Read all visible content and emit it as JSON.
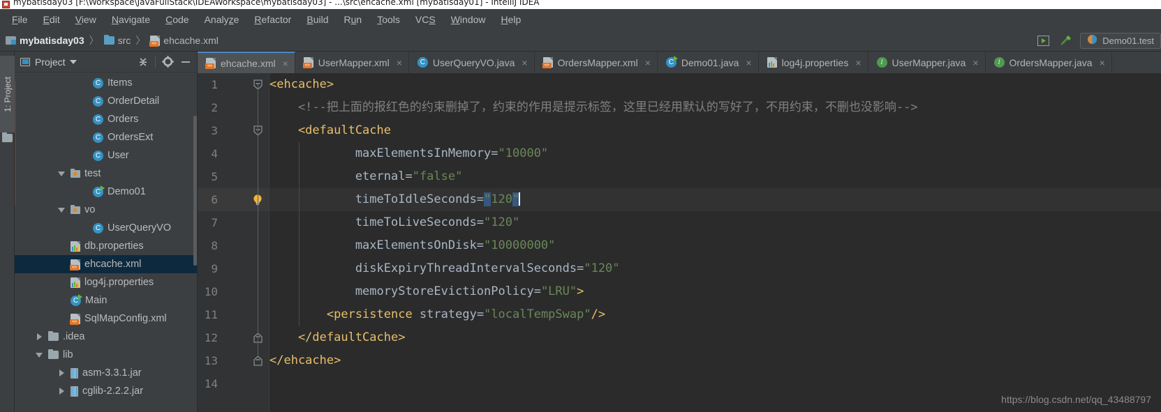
{
  "window": {
    "title": "mybatisday03 [F:\\Workspace\\JavaFullStack\\IDEAWorkspace\\mybatisday03] - ...\\src\\ehcache.xml [mybatisday01] - IntelliJ IDEA",
    "app_icon": "intellij-idea-icon"
  },
  "menubar": {
    "items": [
      {
        "label": "File",
        "mnemonic": "F"
      },
      {
        "label": "Edit",
        "mnemonic": "E"
      },
      {
        "label": "View",
        "mnemonic": "V"
      },
      {
        "label": "Navigate",
        "mnemonic": "N"
      },
      {
        "label": "Code",
        "mnemonic": "C"
      },
      {
        "label": "Analyze",
        "mnemonic": "z"
      },
      {
        "label": "Refactor",
        "mnemonic": "R"
      },
      {
        "label": "Build",
        "mnemonic": "B"
      },
      {
        "label": "Run",
        "mnemonic": "u"
      },
      {
        "label": "Tools",
        "mnemonic": "T"
      },
      {
        "label": "VCS",
        "mnemonic": "S"
      },
      {
        "label": "Window",
        "mnemonic": "W"
      },
      {
        "label": "Help",
        "mnemonic": "H"
      }
    ]
  },
  "navbar": {
    "breadcrumbs": [
      {
        "label": "mybatisday03",
        "icon": "module-icon",
        "bold": true
      },
      {
        "label": "src",
        "icon": "folder-icon",
        "bold": false
      },
      {
        "label": "ehcache.xml",
        "icon": "xml-file-icon",
        "bold": false
      }
    ],
    "separator": "〉",
    "run_button": "run-icon",
    "build_button": "build-hammer-icon",
    "run_config": {
      "label": "Demo01.test",
      "icon": "junit-run-config-icon"
    }
  },
  "toolstrip": {
    "project_tab": "1: Project",
    "folder_icon": "folder-icon"
  },
  "project_panel": {
    "title": "Project",
    "view_icon": "project-view-icon",
    "caret": "chevron-down-icon",
    "actions": [
      {
        "name": "collapse-all-icon"
      },
      {
        "name": "gear-icon"
      },
      {
        "name": "hide-icon"
      }
    ],
    "tree": [
      {
        "label": "Items",
        "icon": "class-icon",
        "indent": 6,
        "toggle": "none",
        "selected": false
      },
      {
        "label": "OrderDetail",
        "icon": "class-icon",
        "indent": 6,
        "toggle": "none",
        "selected": false
      },
      {
        "label": "Orders",
        "icon": "class-icon",
        "indent": 6,
        "toggle": "none",
        "selected": false
      },
      {
        "label": "OrdersExt",
        "icon": "class-icon",
        "indent": 6,
        "toggle": "none",
        "selected": false
      },
      {
        "label": "User",
        "icon": "class-icon",
        "indent": 6,
        "toggle": "none",
        "selected": false
      },
      {
        "label": "test",
        "icon": "source-folder-icon",
        "indent": 4,
        "toggle": "down",
        "selected": false
      },
      {
        "label": "Demo01",
        "icon": "runnable-class-icon",
        "indent": 6,
        "toggle": "none",
        "selected": false
      },
      {
        "label": "vo",
        "icon": "source-folder-icon",
        "indent": 4,
        "toggle": "down",
        "selected": false
      },
      {
        "label": "UserQueryVO",
        "icon": "class-icon",
        "indent": 6,
        "toggle": "none",
        "selected": false
      },
      {
        "label": "db.properties",
        "icon": "properties-icon",
        "indent": 4,
        "toggle": "none",
        "selected": false
      },
      {
        "label": "ehcache.xml",
        "icon": "xml-file-icon",
        "indent": 4,
        "toggle": "none",
        "selected": true
      },
      {
        "label": "log4j.properties",
        "icon": "properties-icon",
        "indent": 4,
        "toggle": "none",
        "selected": false
      },
      {
        "label": "Main",
        "icon": "runnable-class-icon",
        "indent": 4,
        "toggle": "none",
        "selected": false
      },
      {
        "label": "SqlMapConfig.xml",
        "icon": "xml-file-icon",
        "indent": 4,
        "toggle": "none",
        "selected": false
      },
      {
        "label": ".idea",
        "icon": "plain-folder-icon",
        "indent": 2,
        "toggle": "right",
        "selected": false
      },
      {
        "label": "lib",
        "icon": "plain-folder-icon",
        "indent": 2,
        "toggle": "down",
        "selected": false
      },
      {
        "label": "asm-3.3.1.jar",
        "icon": "jar-icon",
        "indent": 4,
        "toggle": "right",
        "selected": false
      },
      {
        "label": "cglib-2.2.2.jar",
        "icon": "jar-icon",
        "indent": 4,
        "toggle": "right",
        "selected": false
      }
    ]
  },
  "editor": {
    "tabs": [
      {
        "label": "ehcache.xml",
        "icon": "xml-file-icon",
        "active": true
      },
      {
        "label": "UserMapper.xml",
        "icon": "xml-file-icon",
        "active": false
      },
      {
        "label": "UserQueryVO.java",
        "icon": "class-icon",
        "active": false
      },
      {
        "label": "OrdersMapper.xml",
        "icon": "xml-file-icon",
        "active": false
      },
      {
        "label": "Demo01.java",
        "icon": "runnable-class-icon",
        "active": false
      },
      {
        "label": "log4j.properties",
        "icon": "properties-icon",
        "active": false
      },
      {
        "label": "UserMapper.java",
        "icon": "interface-icon",
        "active": false
      },
      {
        "label": "OrdersMapper.java",
        "icon": "interface-icon",
        "active": false
      }
    ],
    "close_glyph": "×",
    "lines": [
      {
        "n": 1,
        "fold": "open-top",
        "highlight": false,
        "bulb": false,
        "segments": [
          {
            "t": "<ehcache>",
            "c": "tag",
            "indent": 0
          }
        ]
      },
      {
        "n": 2,
        "fold": "none",
        "highlight": false,
        "bulb": false,
        "segments": [
          {
            "t": "    <!--把上面的报红色的约束删掉了，约束的作用是提示标签，这里已经用默认的写好了，不用约束，不删也没影响-->",
            "c": "cmt",
            "indent": 0
          }
        ]
      },
      {
        "n": 3,
        "fold": "open-mid",
        "highlight": false,
        "bulb": false,
        "segments": [
          {
            "t": "    <defaultCache",
            "c": "tag",
            "indent": 0
          }
        ]
      },
      {
        "n": 4,
        "fold": "none",
        "highlight": false,
        "bulb": false,
        "segments": [
          {
            "t": "            maxElementsInMemory=",
            "c": "attr"
          },
          {
            "t": "\"10000\"",
            "c": "val"
          }
        ]
      },
      {
        "n": 5,
        "fold": "none",
        "highlight": false,
        "bulb": false,
        "segments": [
          {
            "t": "            eternal=",
            "c": "attr"
          },
          {
            "t": "\"false\"",
            "c": "val"
          }
        ]
      },
      {
        "n": 6,
        "fold": "none",
        "highlight": true,
        "bulb": true,
        "segments": [
          {
            "t": "            timeToIdleSeconds=",
            "c": "attr"
          },
          {
            "t": "\"",
            "c": "val sel"
          },
          {
            "t": "120",
            "c": "val"
          },
          {
            "t": "\"",
            "c": "val sel"
          }
        ]
      },
      {
        "n": 7,
        "fold": "none",
        "highlight": false,
        "bulb": false,
        "segments": [
          {
            "t": "            timeToLiveSeconds=",
            "c": "attr"
          },
          {
            "t": "\"120\"",
            "c": "val"
          }
        ]
      },
      {
        "n": 8,
        "fold": "none",
        "highlight": false,
        "bulb": false,
        "segments": [
          {
            "t": "            maxElementsOnDisk=",
            "c": "attr"
          },
          {
            "t": "\"10000000\"",
            "c": "val"
          }
        ]
      },
      {
        "n": 9,
        "fold": "none",
        "highlight": false,
        "bulb": false,
        "segments": [
          {
            "t": "            diskExpiryThreadIntervalSeconds=",
            "c": "attr"
          },
          {
            "t": "\"120\"",
            "c": "val"
          }
        ]
      },
      {
        "n": 10,
        "fold": "none",
        "highlight": false,
        "bulb": false,
        "segments": [
          {
            "t": "            memoryStoreEvictionPolicy=",
            "c": "attr"
          },
          {
            "t": "\"LRU\"",
            "c": "val"
          },
          {
            "t": ">",
            "c": "tag"
          }
        ]
      },
      {
        "n": 11,
        "fold": "none",
        "highlight": false,
        "bulb": false,
        "segments": [
          {
            "t": "        <persistence ",
            "c": "tag"
          },
          {
            "t": "strategy=",
            "c": "attr"
          },
          {
            "t": "\"localTempSwap\"",
            "c": "val"
          },
          {
            "t": "/>",
            "c": "tag"
          }
        ]
      },
      {
        "n": 12,
        "fold": "close-mid",
        "highlight": false,
        "bulb": false,
        "segments": [
          {
            "t": "    </defaultCache>",
            "c": "tag"
          }
        ]
      },
      {
        "n": 13,
        "fold": "close-top",
        "highlight": false,
        "bulb": false,
        "segments": [
          {
            "t": "</ehcache>",
            "c": "tag"
          }
        ]
      },
      {
        "n": 14,
        "fold": "none",
        "highlight": false,
        "bulb": false,
        "segments": []
      }
    ]
  },
  "watermark": "https://blog.csdn.net/qq_43488797",
  "colors": {
    "accent_blue": "#3592c4",
    "tag": "#e8bf6a",
    "value": "#6a8759",
    "comment": "#808080",
    "text": "#a9b7c6",
    "selection": "#365880",
    "editor_bg": "#2b2b2b",
    "panel_bg": "#3c3f41",
    "tree_selected": "#0d293e"
  }
}
